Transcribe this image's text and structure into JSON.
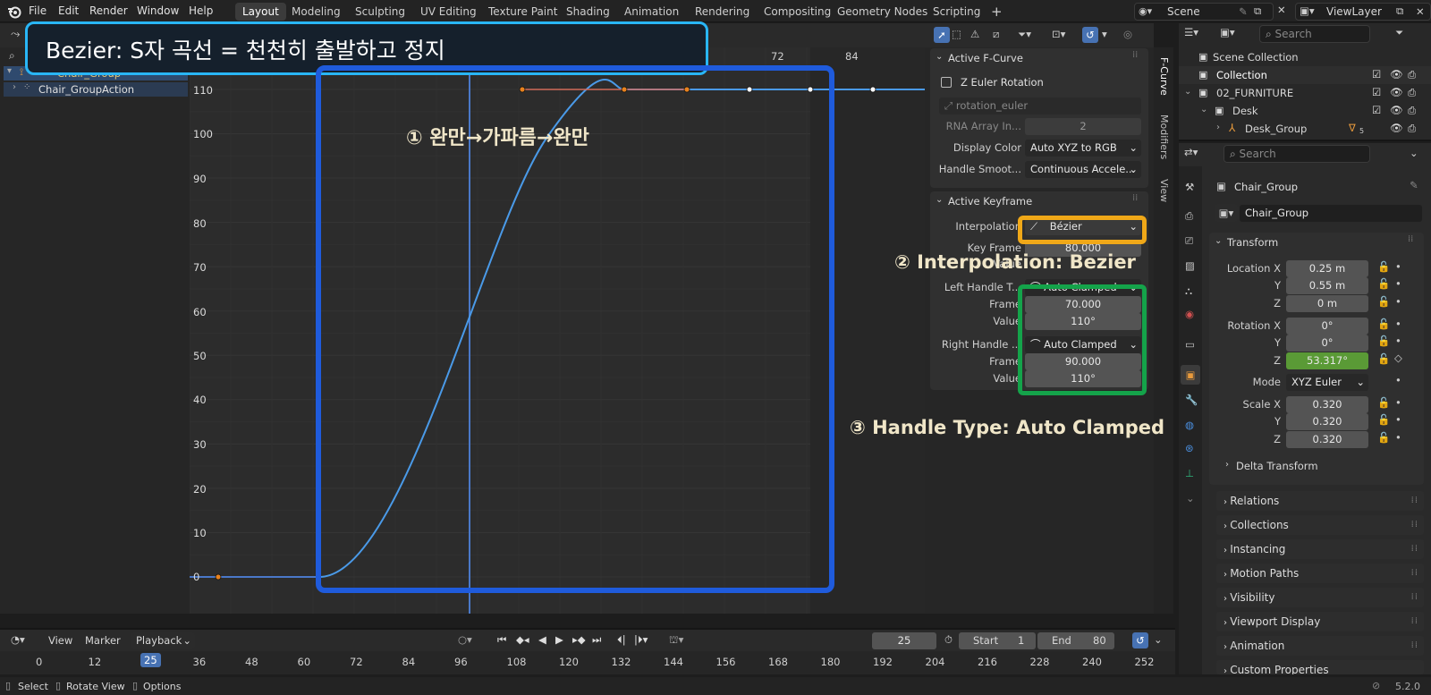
{
  "menu": {
    "items": [
      "File",
      "Edit",
      "Render",
      "Window",
      "Help"
    ],
    "workspaces": [
      "Layout",
      "Modeling",
      "Sculpting",
      "UV Editing",
      "Texture Paint",
      "Shading",
      "Animation",
      "Rendering",
      "Compositing",
      "Geometry Nodes",
      "Scripting"
    ],
    "active_workspace": "Layout",
    "add_tab": "+",
    "scene": "Scene",
    "view_layer": "ViewLayer"
  },
  "overlay": {
    "title": "Bezier: S자 곡선 = 천천히 출발하고 정지",
    "note1": "① 완만→가파름→완만",
    "note2": "② Interpolation: Bezier",
    "note3": "③ Handle Type: Auto Clamped",
    "colors": {
      "title_border": "#29b6f6",
      "curve_box": "#1f5bdc",
      "interp_box": "#f0a818",
      "handle_box": "#14a34a",
      "note_text": "#f0e6c8"
    }
  },
  "channels": {
    "items": [
      {
        "label": "Chair_Group"
      },
      {
        "label": "Chair_GroupAction"
      }
    ]
  },
  "graph": {
    "frame_labels": [
      "72",
      "84"
    ],
    "y_labels": [
      "110",
      "100",
      "90",
      "80",
      "70",
      "60",
      "50",
      "40",
      "30",
      "20",
      "10",
      "0"
    ],
    "current_frame_label": "25"
  },
  "fcurve_panel": {
    "section_title": "Active F-Curve",
    "channel_name": "Z Euler Rotation",
    "data_path": "rotation_euler",
    "rna_label": "RNA Array In...",
    "rna_value": "2",
    "display_color_label": "Display Color",
    "display_color_value": "Auto XYZ to RGB",
    "handle_smooth_label": "Handle Smoot...",
    "handle_smooth_value": "Continuous Accele..."
  },
  "keyframe_panel": {
    "section_title": "Active Keyframe",
    "interpolation_label": "Interpolation",
    "interpolation_value": "Bézier",
    "key_frame_label": "Key Frame",
    "key_frame_value": "80.000",
    "value_label": "Value",
    "left_handle_label": "Left Handle T...",
    "left_handle_type": "Auto Clamped",
    "left_frame_label": "Frame",
    "left_frame_value": "70.000",
    "left_value_label": "Value",
    "left_value_value": "110°",
    "right_handle_label": "Right Handle ...",
    "right_handle_type": "Auto Clamped",
    "right_frame_label": "Frame",
    "right_frame_value": "90.000",
    "right_value_label": "Value",
    "right_value_value": "110°"
  },
  "side_tabs": [
    "F-Curve",
    "Modifiers",
    "View"
  ],
  "outliner": {
    "search_placeholder": "Search",
    "items": [
      {
        "label": "Scene Collection"
      },
      {
        "label": "Collection"
      },
      {
        "label": "02_FURNITURE"
      },
      {
        "label": "Desk"
      },
      {
        "label": "Desk_Group",
        "badge": "5"
      }
    ]
  },
  "properties": {
    "search_placeholder": "Search",
    "object_name": "Chair_Group",
    "object_field": "Chair_Group",
    "transform_title": "Transform",
    "location_label": "Location X",
    "location": [
      "0.25 m",
      "0.55 m",
      "0 m"
    ],
    "rotation_label": "Rotation X",
    "rotation": [
      "0°",
      "0°",
      "53.317°"
    ],
    "axis_y": "Y",
    "axis_z": "Z",
    "mode_label": "Mode",
    "mode_value": "XYZ Euler",
    "scale_label": "Scale X",
    "scale": [
      "0.320",
      "0.320",
      "0.320"
    ],
    "delta_transform": "Delta Transform",
    "sections": [
      "Relations",
      "Collections",
      "Instancing",
      "Motion Paths",
      "Visibility",
      "Viewport Display",
      "Animation",
      "Custom Properties"
    ]
  },
  "timeline": {
    "view": "View",
    "marker": "Marker",
    "playback": "Playback",
    "current_frame": "25",
    "start_label": "Start",
    "start_value": "1",
    "end_label": "End",
    "end_value": "80",
    "ruler": [
      "0",
      "12",
      "25",
      "36",
      "48",
      "60",
      "72",
      "84",
      "96",
      "108",
      "120",
      "132",
      "144",
      "156",
      "168",
      "180",
      "192",
      "204",
      "216",
      "228",
      "240",
      "252"
    ]
  },
  "statusbar": {
    "select": "Select",
    "rotate_view": "Rotate View",
    "options": "Options",
    "version": "5.2.0"
  }
}
